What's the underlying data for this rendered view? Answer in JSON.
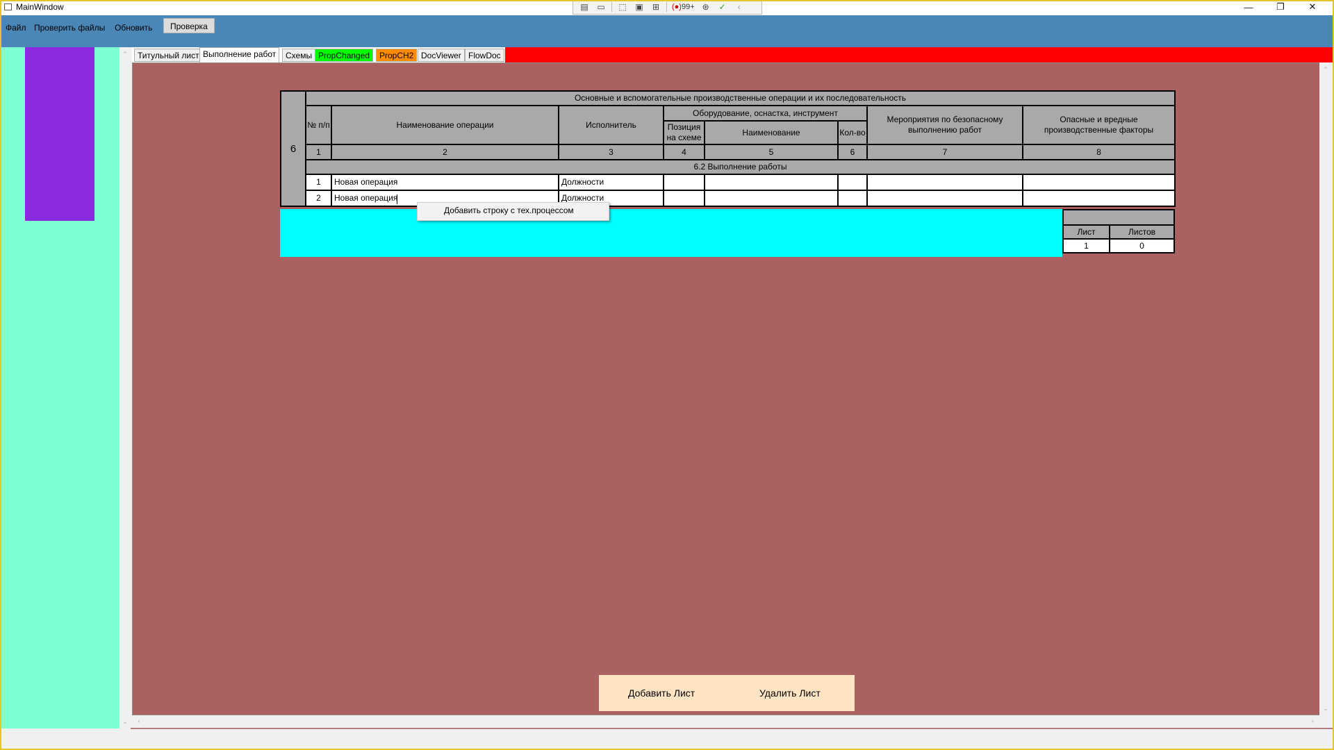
{
  "window": {
    "title": "MainWindow"
  },
  "debug_toolbar": {
    "count": "99+",
    "record_marker": "(●)"
  },
  "menu": {
    "file": "Файл",
    "check_files": "Проверить файлы",
    "refresh": "Обновить",
    "verify": "Проверка"
  },
  "tabs": [
    {
      "label": "Титульный лист",
      "color": "#f0f0f0"
    },
    {
      "label": "Выполнение работ",
      "color": "#ffffff",
      "active": true
    },
    {
      "label": "Схемы",
      "color": "#f0f0f0"
    },
    {
      "label": "PropChanged",
      "color": "#00ff00"
    },
    {
      "label": "PropCH2",
      "color": "#ff8c00"
    },
    {
      "label": "DocViewer",
      "color": "#f0f0f0"
    },
    {
      "label": "FlowDoc",
      "color": "#f0f0f0"
    }
  ],
  "colors": {
    "menubar": "#4a86b6",
    "left_panel": "#7fffd4",
    "purple_block": "#8a2be2",
    "content_bg": "#ab6161",
    "tabstrip": "#ff0000",
    "cyan_block": "#00ffff",
    "buttons_bg": "#ffe4c4",
    "header_cell": "#a9a9a9",
    "frame": "#e3c52d"
  },
  "document": {
    "section_number": "6",
    "title": "Основные и вспомогательные производственные операции и их последовательность",
    "headers": {
      "num": "№ п/п",
      "operation": "Наименование операции",
      "executor": "Исполнитель",
      "equipment_group": "Оборудование, оснастка, инструмент",
      "position": "Позиция на схеме",
      "name": "Наименование",
      "qty": "Кол-во",
      "safety": "Мероприятия по безопасному выполнению работ",
      "hazards": "Опасные и вредные производственные факторы"
    },
    "column_numbers": [
      "1",
      "2",
      "3",
      "4",
      "5",
      "6",
      "7",
      "8"
    ],
    "subsection": "6.2 Выполнение работы",
    "rows": [
      {
        "num": "1",
        "operation": "Новая операция",
        "executor": "Должности"
      },
      {
        "num": "2",
        "operation": "Новая операция",
        "executor": "Должности"
      }
    ],
    "sheet_box": {
      "sheet_label": "Лист",
      "sheets_label": "Листов",
      "sheet": "1",
      "sheets": "0"
    }
  },
  "context_menu": {
    "items": [
      "Добавить строку с тех.процессом"
    ]
  },
  "buttons": {
    "add_sheet": "Добавить Лист",
    "delete_sheet": "Удалить Лист"
  }
}
